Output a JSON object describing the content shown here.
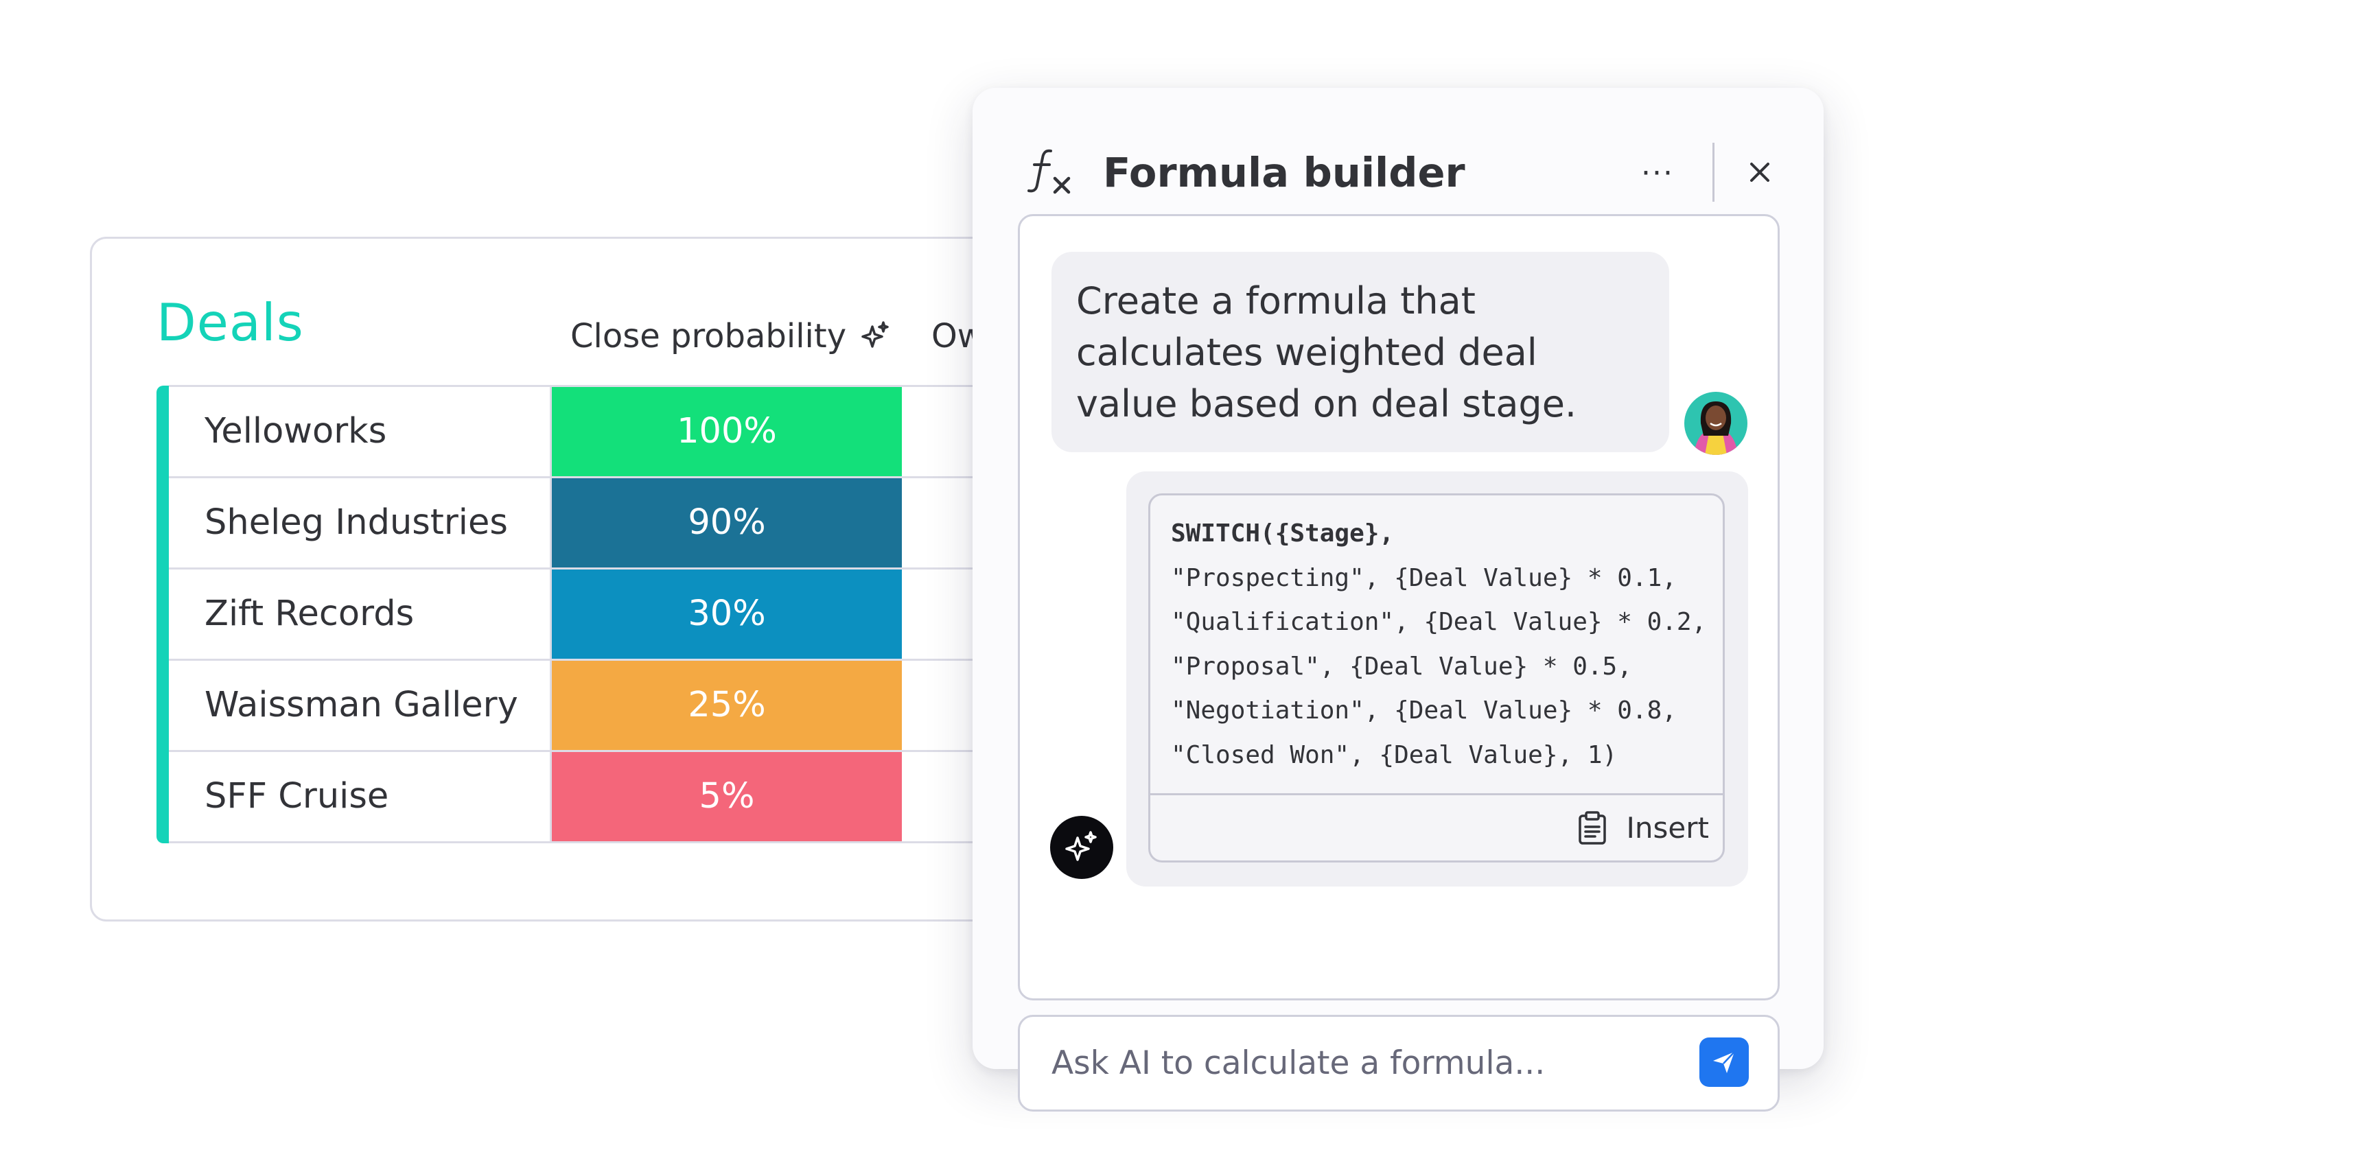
{
  "deals_board": {
    "title": "Deals",
    "columns": {
      "probability": "Close probability",
      "owner": "Ow"
    },
    "rows": [
      {
        "name": "Yelloworks",
        "probability": "100%",
        "color": "#13e07a"
      },
      {
        "name": "Sheleg Industries",
        "probability": "90%",
        "color": "#1b7296"
      },
      {
        "name": "Zift Records",
        "probability": "30%",
        "color": "#0c90c0"
      },
      {
        "name": "Waissman Gallery",
        "probability": "25%",
        "color": "#f4a943"
      },
      {
        "name": "SFF Cruise",
        "probability": "5%",
        "color": "#f4667a"
      }
    ],
    "group_color": "#14d3b8"
  },
  "formula_builder": {
    "title": "Formula builder",
    "more_label": "···",
    "user_message": "Create a formula that calculates weighted deal value based on deal stage.",
    "code_first_line": "SWITCH({Stage},",
    "code_lines": [
      "\"Prospecting\", {Deal Value} * 0.1,",
      "\"Qualification\", {Deal Value} * 0.2,",
      "\"Proposal\", {Deal Value} * 0.5,",
      "\"Negotiation\", {Deal Value} * 0.8,",
      "\"Closed Won\", {Deal Value}, 1)"
    ],
    "insert_label": "Insert",
    "input_placeholder": "Ask AI to calculate a formula...",
    "accent_color": "#1f76f0"
  }
}
